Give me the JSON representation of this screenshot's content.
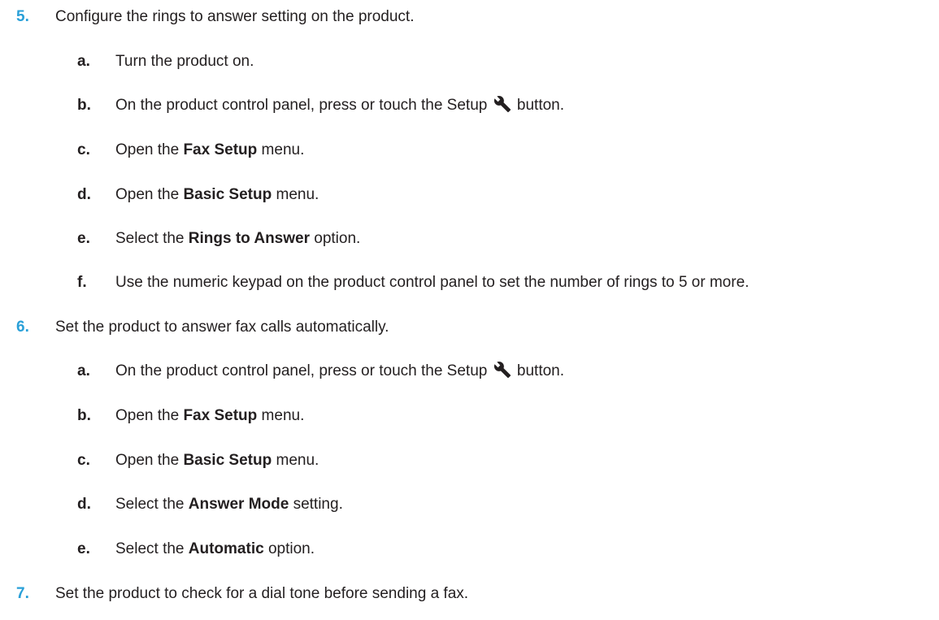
{
  "steps": [
    {
      "number": "5.",
      "text": "Configure the rings to answer setting on the product.",
      "substeps": [
        {
          "letter": "a.",
          "pre": "Turn the product on.",
          "bold": "",
          "post": ""
        },
        {
          "letter": "b.",
          "pre": "On the product control panel, press or touch the Setup",
          "icon": "wrench-icon",
          "post": "button."
        },
        {
          "letter": "c.",
          "pre": "Open the ",
          "bold": "Fax Setup",
          "post": " menu."
        },
        {
          "letter": "d.",
          "pre": "Open the ",
          "bold": "Basic Setup",
          "post": " menu."
        },
        {
          "letter": "e.",
          "pre": "Select the ",
          "bold": "Rings to Answer",
          "post": " option."
        },
        {
          "letter": "f.",
          "pre": "Use the numeric keypad on the product control panel to set the number of rings to 5 or more.",
          "bold": "",
          "post": ""
        }
      ]
    },
    {
      "number": "6.",
      "text": "Set the product to answer fax calls automatically.",
      "substeps": [
        {
          "letter": "a.",
          "pre": "On the product control panel, press or touch the Setup",
          "icon": "wrench-icon",
          "post": "button."
        },
        {
          "letter": "b.",
          "pre": "Open the ",
          "bold": "Fax Setup",
          "post": " menu."
        },
        {
          "letter": "c.",
          "pre": "Open the ",
          "bold": "Basic Setup",
          "post": " menu."
        },
        {
          "letter": "d.",
          "pre": "Select the ",
          "bold": "Answer Mode",
          "post": " setting."
        },
        {
          "letter": "e.",
          "pre": "Select the ",
          "bold": "Automatic",
          "post": " option."
        }
      ]
    },
    {
      "number": "7.",
      "text": "Set the product to check for a dial tone before sending a fax.",
      "substeps": []
    }
  ],
  "colors": {
    "step_number": "#2aa0d8",
    "text": "#231f20"
  }
}
